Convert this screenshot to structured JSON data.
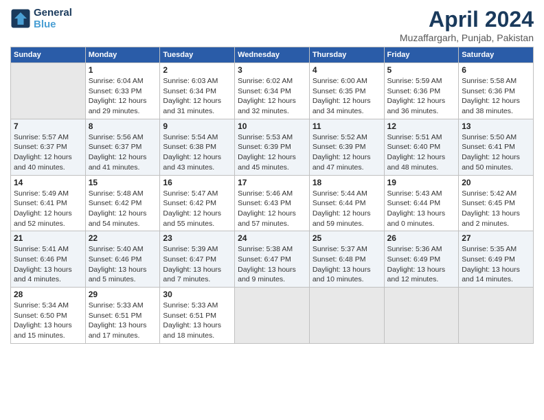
{
  "header": {
    "logo_line1": "General",
    "logo_line2": "Blue",
    "title": "April 2024",
    "subtitle": "Muzaffargarh, Punjab, Pakistan"
  },
  "days_of_week": [
    "Sunday",
    "Monday",
    "Tuesday",
    "Wednesday",
    "Thursday",
    "Friday",
    "Saturday"
  ],
  "weeks": [
    [
      {
        "day": "",
        "info": ""
      },
      {
        "day": "1",
        "info": "Sunrise: 6:04 AM\nSunset: 6:33 PM\nDaylight: 12 hours\nand 29 minutes."
      },
      {
        "day": "2",
        "info": "Sunrise: 6:03 AM\nSunset: 6:34 PM\nDaylight: 12 hours\nand 31 minutes."
      },
      {
        "day": "3",
        "info": "Sunrise: 6:02 AM\nSunset: 6:34 PM\nDaylight: 12 hours\nand 32 minutes."
      },
      {
        "day": "4",
        "info": "Sunrise: 6:00 AM\nSunset: 6:35 PM\nDaylight: 12 hours\nand 34 minutes."
      },
      {
        "day": "5",
        "info": "Sunrise: 5:59 AM\nSunset: 6:36 PM\nDaylight: 12 hours\nand 36 minutes."
      },
      {
        "day": "6",
        "info": "Sunrise: 5:58 AM\nSunset: 6:36 PM\nDaylight: 12 hours\nand 38 minutes."
      }
    ],
    [
      {
        "day": "7",
        "info": "Sunrise: 5:57 AM\nSunset: 6:37 PM\nDaylight: 12 hours\nand 40 minutes."
      },
      {
        "day": "8",
        "info": "Sunrise: 5:56 AM\nSunset: 6:37 PM\nDaylight: 12 hours\nand 41 minutes."
      },
      {
        "day": "9",
        "info": "Sunrise: 5:54 AM\nSunset: 6:38 PM\nDaylight: 12 hours\nand 43 minutes."
      },
      {
        "day": "10",
        "info": "Sunrise: 5:53 AM\nSunset: 6:39 PM\nDaylight: 12 hours\nand 45 minutes."
      },
      {
        "day": "11",
        "info": "Sunrise: 5:52 AM\nSunset: 6:39 PM\nDaylight: 12 hours\nand 47 minutes."
      },
      {
        "day": "12",
        "info": "Sunrise: 5:51 AM\nSunset: 6:40 PM\nDaylight: 12 hours\nand 48 minutes."
      },
      {
        "day": "13",
        "info": "Sunrise: 5:50 AM\nSunset: 6:41 PM\nDaylight: 12 hours\nand 50 minutes."
      }
    ],
    [
      {
        "day": "14",
        "info": "Sunrise: 5:49 AM\nSunset: 6:41 PM\nDaylight: 12 hours\nand 52 minutes."
      },
      {
        "day": "15",
        "info": "Sunrise: 5:48 AM\nSunset: 6:42 PM\nDaylight: 12 hours\nand 54 minutes."
      },
      {
        "day": "16",
        "info": "Sunrise: 5:47 AM\nSunset: 6:42 PM\nDaylight: 12 hours\nand 55 minutes."
      },
      {
        "day": "17",
        "info": "Sunrise: 5:46 AM\nSunset: 6:43 PM\nDaylight: 12 hours\nand 57 minutes."
      },
      {
        "day": "18",
        "info": "Sunrise: 5:44 AM\nSunset: 6:44 PM\nDaylight: 12 hours\nand 59 minutes."
      },
      {
        "day": "19",
        "info": "Sunrise: 5:43 AM\nSunset: 6:44 PM\nDaylight: 13 hours\nand 0 minutes."
      },
      {
        "day": "20",
        "info": "Sunrise: 5:42 AM\nSunset: 6:45 PM\nDaylight: 13 hours\nand 2 minutes."
      }
    ],
    [
      {
        "day": "21",
        "info": "Sunrise: 5:41 AM\nSunset: 6:46 PM\nDaylight: 13 hours\nand 4 minutes."
      },
      {
        "day": "22",
        "info": "Sunrise: 5:40 AM\nSunset: 6:46 PM\nDaylight: 13 hours\nand 5 minutes."
      },
      {
        "day": "23",
        "info": "Sunrise: 5:39 AM\nSunset: 6:47 PM\nDaylight: 13 hours\nand 7 minutes."
      },
      {
        "day": "24",
        "info": "Sunrise: 5:38 AM\nSunset: 6:47 PM\nDaylight: 13 hours\nand 9 minutes."
      },
      {
        "day": "25",
        "info": "Sunrise: 5:37 AM\nSunset: 6:48 PM\nDaylight: 13 hours\nand 10 minutes."
      },
      {
        "day": "26",
        "info": "Sunrise: 5:36 AM\nSunset: 6:49 PM\nDaylight: 13 hours\nand 12 minutes."
      },
      {
        "day": "27",
        "info": "Sunrise: 5:35 AM\nSunset: 6:49 PM\nDaylight: 13 hours\nand 14 minutes."
      }
    ],
    [
      {
        "day": "28",
        "info": "Sunrise: 5:34 AM\nSunset: 6:50 PM\nDaylight: 13 hours\nand 15 minutes."
      },
      {
        "day": "29",
        "info": "Sunrise: 5:33 AM\nSunset: 6:51 PM\nDaylight: 13 hours\nand 17 minutes."
      },
      {
        "day": "30",
        "info": "Sunrise: 5:33 AM\nSunset: 6:51 PM\nDaylight: 13 hours\nand 18 minutes."
      },
      {
        "day": "",
        "info": ""
      },
      {
        "day": "",
        "info": ""
      },
      {
        "day": "",
        "info": ""
      },
      {
        "day": "",
        "info": ""
      }
    ]
  ]
}
